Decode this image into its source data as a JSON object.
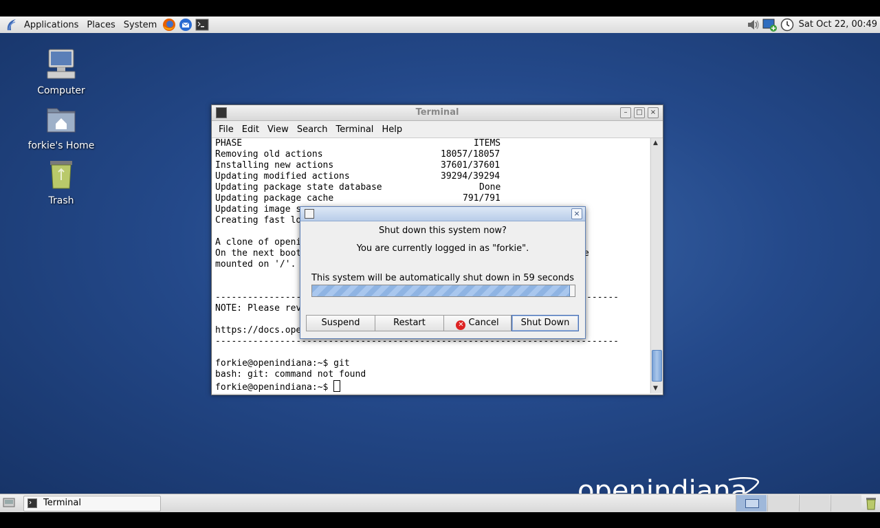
{
  "top_panel": {
    "menus": [
      "Applications",
      "Places",
      "System"
    ],
    "clock": "Sat Oct 22, 00:49"
  },
  "desktop": {
    "icons": [
      {
        "label": "Computer",
        "icon": "computer-icon"
      },
      {
        "label": "forkie's Home",
        "icon": "home-folder-icon"
      },
      {
        "label": "Trash",
        "icon": "trash-icon"
      }
    ],
    "logo_text": "openindiana"
  },
  "terminal": {
    "title": "Terminal",
    "menus": [
      "File",
      "Edit",
      "View",
      "Search",
      "Terminal",
      "Help"
    ],
    "table_rows": [
      {
        "phase": "PHASE",
        "items": "ITEMS"
      },
      {
        "phase": "Removing old actions",
        "items": "18057/18057"
      },
      {
        "phase": "Installing new actions",
        "items": "37601/37601"
      },
      {
        "phase": "Updating modified actions",
        "items": "39294/39294"
      },
      {
        "phase": "Updating package state database",
        "items": "Done"
      },
      {
        "phase": "Updating package cache",
        "items": "791/791"
      },
      {
        "phase": "Updating image s",
        "items": ""
      },
      {
        "phase": "Creating fast lo",
        "items": ""
      }
    ],
    "lines_after": [
      {
        "left": "A clone of openi",
        "right": ""
      },
      {
        "left": "On the next boot",
        "right": "e"
      },
      {
        "left": "mounted on '/'.",
        "right": ""
      }
    ],
    "separator": "---------------------------------------------------------------------------",
    "note": "NOTE: Please rev",
    "url": "https://docs.ope",
    "prompt1": "forkie@openindiana:~$ git",
    "error": "bash: git: command not found",
    "prompt2": "forkie@openindiana:~$ "
  },
  "dialog": {
    "question": "Shut down this system now?",
    "logged_in": "You are currently logged in as \"forkie\".",
    "countdown": "This system will be automatically shut down in 59 seconds",
    "progress_fraction": 0.98,
    "buttons": {
      "suspend": "Suspend",
      "restart": "Restart",
      "cancel": "Cancel",
      "shutdown": "Shut Down"
    }
  },
  "bottom_panel": {
    "task": "Terminal"
  },
  "colors": {
    "desktop": "#24498a",
    "selection_blue": "#8fb4e3"
  }
}
